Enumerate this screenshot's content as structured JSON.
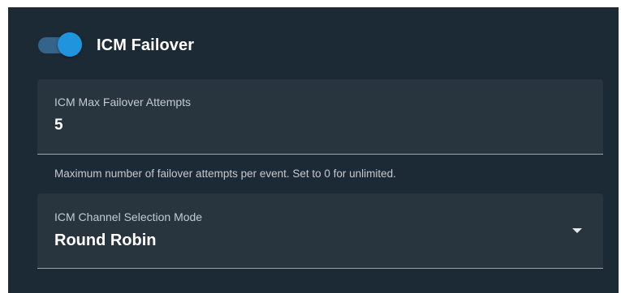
{
  "failover": {
    "toggle_label": "ICM Failover",
    "enabled": true
  },
  "max_attempts": {
    "label": "ICM Max Failover Attempts",
    "value": "5",
    "helper": "Maximum number of failover attempts per event. Set to 0 for unlimited."
  },
  "channel_mode": {
    "label": "ICM Channel Selection Mode",
    "value": "Round Robin",
    "icon": "chevron-down-icon"
  },
  "colors": {
    "panel_background": "#1c2a36",
    "field_background": "#28353f",
    "toggle_track": "#35648a",
    "toggle_thumb": "#1f95dd",
    "text_primary": "#ffffff",
    "text_secondary": "#c4cad0"
  }
}
